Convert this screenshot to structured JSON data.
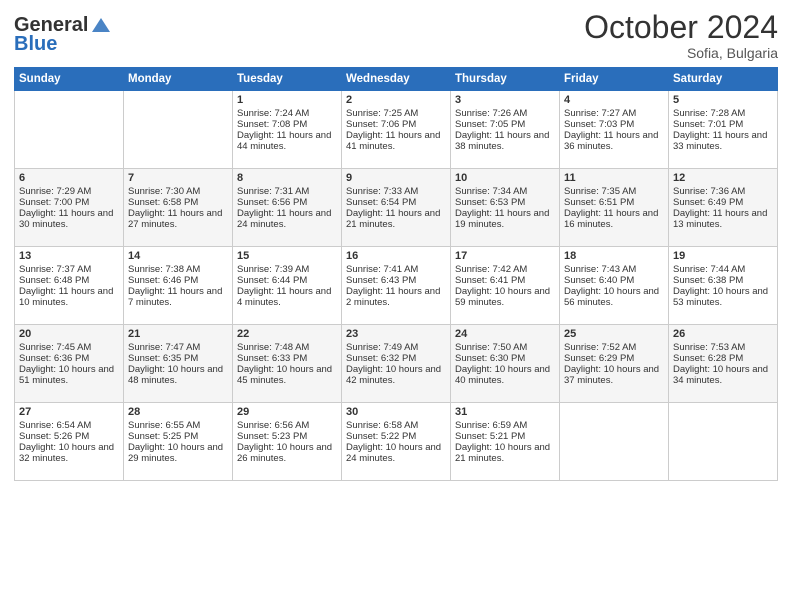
{
  "header": {
    "logo_line1": "General",
    "logo_line2": "Blue",
    "month": "October 2024",
    "location": "Sofia, Bulgaria"
  },
  "days_of_week": [
    "Sunday",
    "Monday",
    "Tuesday",
    "Wednesday",
    "Thursday",
    "Friday",
    "Saturday"
  ],
  "weeks": [
    [
      {
        "day": "",
        "sunrise": "",
        "sunset": "",
        "daylight": ""
      },
      {
        "day": "",
        "sunrise": "",
        "sunset": "",
        "daylight": ""
      },
      {
        "day": "1",
        "sunrise": "Sunrise: 7:24 AM",
        "sunset": "Sunset: 7:08 PM",
        "daylight": "Daylight: 11 hours and 44 minutes."
      },
      {
        "day": "2",
        "sunrise": "Sunrise: 7:25 AM",
        "sunset": "Sunset: 7:06 PM",
        "daylight": "Daylight: 11 hours and 41 minutes."
      },
      {
        "day": "3",
        "sunrise": "Sunrise: 7:26 AM",
        "sunset": "Sunset: 7:05 PM",
        "daylight": "Daylight: 11 hours and 38 minutes."
      },
      {
        "day": "4",
        "sunrise": "Sunrise: 7:27 AM",
        "sunset": "Sunset: 7:03 PM",
        "daylight": "Daylight: 11 hours and 36 minutes."
      },
      {
        "day": "5",
        "sunrise": "Sunrise: 7:28 AM",
        "sunset": "Sunset: 7:01 PM",
        "daylight": "Daylight: 11 hours and 33 minutes."
      }
    ],
    [
      {
        "day": "6",
        "sunrise": "Sunrise: 7:29 AM",
        "sunset": "Sunset: 7:00 PM",
        "daylight": "Daylight: 11 hours and 30 minutes."
      },
      {
        "day": "7",
        "sunrise": "Sunrise: 7:30 AM",
        "sunset": "Sunset: 6:58 PM",
        "daylight": "Daylight: 11 hours and 27 minutes."
      },
      {
        "day": "8",
        "sunrise": "Sunrise: 7:31 AM",
        "sunset": "Sunset: 6:56 PM",
        "daylight": "Daylight: 11 hours and 24 minutes."
      },
      {
        "day": "9",
        "sunrise": "Sunrise: 7:33 AM",
        "sunset": "Sunset: 6:54 PM",
        "daylight": "Daylight: 11 hours and 21 minutes."
      },
      {
        "day": "10",
        "sunrise": "Sunrise: 7:34 AM",
        "sunset": "Sunset: 6:53 PM",
        "daylight": "Daylight: 11 hours and 19 minutes."
      },
      {
        "day": "11",
        "sunrise": "Sunrise: 7:35 AM",
        "sunset": "Sunset: 6:51 PM",
        "daylight": "Daylight: 11 hours and 16 minutes."
      },
      {
        "day": "12",
        "sunrise": "Sunrise: 7:36 AM",
        "sunset": "Sunset: 6:49 PM",
        "daylight": "Daylight: 11 hours and 13 minutes."
      }
    ],
    [
      {
        "day": "13",
        "sunrise": "Sunrise: 7:37 AM",
        "sunset": "Sunset: 6:48 PM",
        "daylight": "Daylight: 11 hours and 10 minutes."
      },
      {
        "day": "14",
        "sunrise": "Sunrise: 7:38 AM",
        "sunset": "Sunset: 6:46 PM",
        "daylight": "Daylight: 11 hours and 7 minutes."
      },
      {
        "day": "15",
        "sunrise": "Sunrise: 7:39 AM",
        "sunset": "Sunset: 6:44 PM",
        "daylight": "Daylight: 11 hours and 4 minutes."
      },
      {
        "day": "16",
        "sunrise": "Sunrise: 7:41 AM",
        "sunset": "Sunset: 6:43 PM",
        "daylight": "Daylight: 11 hours and 2 minutes."
      },
      {
        "day": "17",
        "sunrise": "Sunrise: 7:42 AM",
        "sunset": "Sunset: 6:41 PM",
        "daylight": "Daylight: 10 hours and 59 minutes."
      },
      {
        "day": "18",
        "sunrise": "Sunrise: 7:43 AM",
        "sunset": "Sunset: 6:40 PM",
        "daylight": "Daylight: 10 hours and 56 minutes."
      },
      {
        "day": "19",
        "sunrise": "Sunrise: 7:44 AM",
        "sunset": "Sunset: 6:38 PM",
        "daylight": "Daylight: 10 hours and 53 minutes."
      }
    ],
    [
      {
        "day": "20",
        "sunrise": "Sunrise: 7:45 AM",
        "sunset": "Sunset: 6:36 PM",
        "daylight": "Daylight: 10 hours and 51 minutes."
      },
      {
        "day": "21",
        "sunrise": "Sunrise: 7:47 AM",
        "sunset": "Sunset: 6:35 PM",
        "daylight": "Daylight: 10 hours and 48 minutes."
      },
      {
        "day": "22",
        "sunrise": "Sunrise: 7:48 AM",
        "sunset": "Sunset: 6:33 PM",
        "daylight": "Daylight: 10 hours and 45 minutes."
      },
      {
        "day": "23",
        "sunrise": "Sunrise: 7:49 AM",
        "sunset": "Sunset: 6:32 PM",
        "daylight": "Daylight: 10 hours and 42 minutes."
      },
      {
        "day": "24",
        "sunrise": "Sunrise: 7:50 AM",
        "sunset": "Sunset: 6:30 PM",
        "daylight": "Daylight: 10 hours and 40 minutes."
      },
      {
        "day": "25",
        "sunrise": "Sunrise: 7:52 AM",
        "sunset": "Sunset: 6:29 PM",
        "daylight": "Daylight: 10 hours and 37 minutes."
      },
      {
        "day": "26",
        "sunrise": "Sunrise: 7:53 AM",
        "sunset": "Sunset: 6:28 PM",
        "daylight": "Daylight: 10 hours and 34 minutes."
      }
    ],
    [
      {
        "day": "27",
        "sunrise": "Sunrise: 6:54 AM",
        "sunset": "Sunset: 5:26 PM",
        "daylight": "Daylight: 10 hours and 32 minutes."
      },
      {
        "day": "28",
        "sunrise": "Sunrise: 6:55 AM",
        "sunset": "Sunset: 5:25 PM",
        "daylight": "Daylight: 10 hours and 29 minutes."
      },
      {
        "day": "29",
        "sunrise": "Sunrise: 6:56 AM",
        "sunset": "Sunset: 5:23 PM",
        "daylight": "Daylight: 10 hours and 26 minutes."
      },
      {
        "day": "30",
        "sunrise": "Sunrise: 6:58 AM",
        "sunset": "Sunset: 5:22 PM",
        "daylight": "Daylight: 10 hours and 24 minutes."
      },
      {
        "day": "31",
        "sunrise": "Sunrise: 6:59 AM",
        "sunset": "Sunset: 5:21 PM",
        "daylight": "Daylight: 10 hours and 21 minutes."
      },
      {
        "day": "",
        "sunrise": "",
        "sunset": "",
        "daylight": ""
      },
      {
        "day": "",
        "sunrise": "",
        "sunset": "",
        "daylight": ""
      }
    ]
  ]
}
